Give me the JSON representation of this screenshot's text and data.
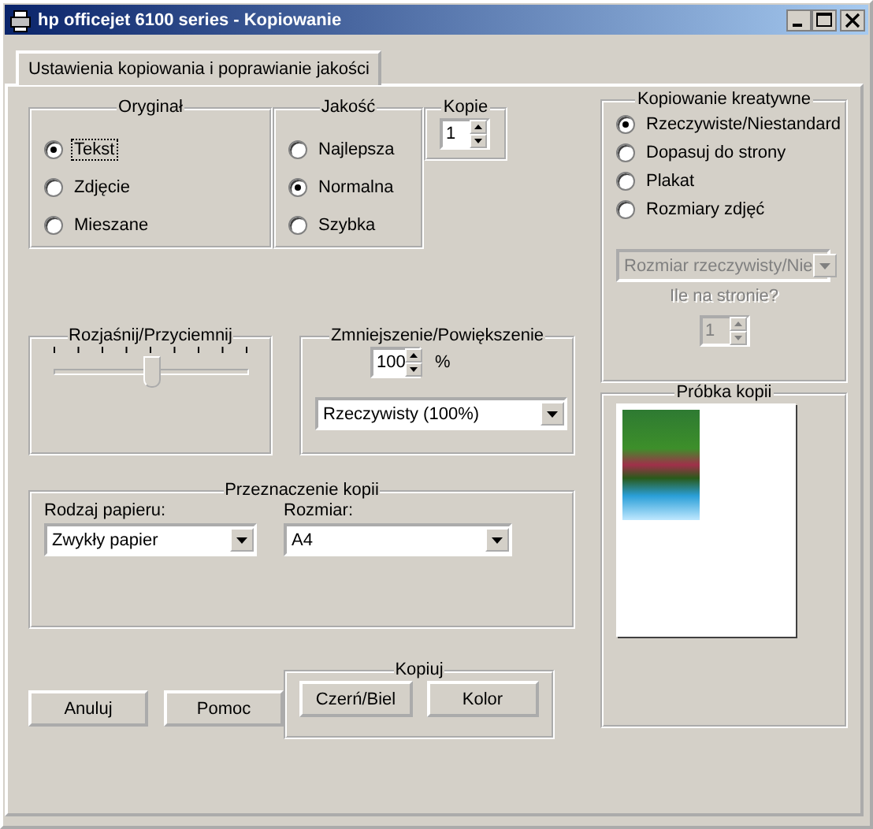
{
  "window": {
    "title": "hp officejet 6100 series - Kopiowanie"
  },
  "tabs": [
    {
      "label": "Ustawienia kopiowania i poprawianie jakości",
      "selected": true
    }
  ],
  "original": {
    "title": "Oryginał",
    "options": [
      {
        "label": "Tekst",
        "selected": true,
        "focused": true
      },
      {
        "label": "Zdjęcie",
        "selected": false,
        "focused": false
      },
      {
        "label": "Mieszane",
        "selected": false,
        "focused": false
      }
    ]
  },
  "quality": {
    "title": "Jakość",
    "options": [
      {
        "label": "Najlepsza",
        "selected": false,
        "focused": false
      },
      {
        "label": "Normalna",
        "selected": true,
        "focused": false
      },
      {
        "label": "Szybka",
        "selected": false,
        "focused": false
      }
    ]
  },
  "copies": {
    "title": "Kopie",
    "value": "1"
  },
  "creative": {
    "title": "Kopiowanie kreatywne",
    "options": [
      {
        "label": "Rzeczywiste/Niestandard",
        "selected": true,
        "focused": false
      },
      {
        "label": "Dopasuj do strony",
        "selected": false,
        "focused": false
      },
      {
        "label": "Plakat",
        "selected": false,
        "focused": false
      },
      {
        "label": "Rozmiary zdjęć",
        "selected": false,
        "focused": false
      }
    ],
    "size_dropdown": {
      "value": "Rozmiar rzeczywisty/Nie",
      "disabled": true
    },
    "per_page": {
      "label": "Ile na stronie?",
      "value": "1",
      "disabled": true
    }
  },
  "brightness": {
    "title": "Rozjaśnij/Przyciemnij",
    "level": 0.5
  },
  "scaling": {
    "title": "Zmniejszenie/Powiększenie",
    "dropdown": "Rzeczywisty (100%)",
    "value": "100",
    "unit": "%"
  },
  "preview": {
    "title": "Próbka kopii"
  },
  "destination": {
    "title": "Przeznaczenie kopii",
    "fields": [
      {
        "label": "Rodzaj papieru:",
        "value": "Zwykły papier"
      },
      {
        "label": "Rozmiar:",
        "value": "A4"
      }
    ]
  },
  "buttons": [
    {
      "label": "Anuluj"
    },
    {
      "label": "Pomoc"
    }
  ],
  "copy": {
    "title": "Kopiuj",
    "buttons": [
      {
        "label": "Czerń/Biel"
      },
      {
        "label": "Kolor"
      }
    ]
  }
}
